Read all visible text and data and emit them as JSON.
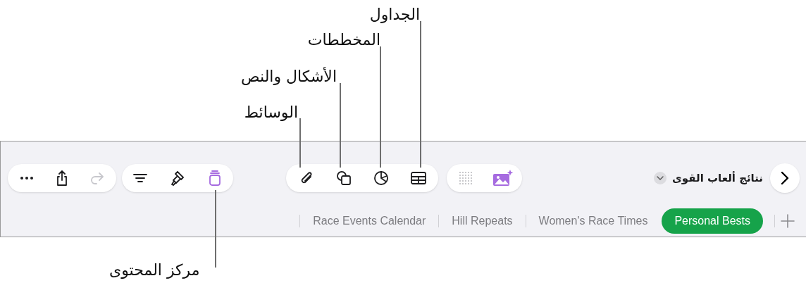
{
  "callouts": [
    {
      "text": "الجداول"
    },
    {
      "text": "المخططات"
    },
    {
      "text": "الأشكال والنص"
    },
    {
      "text": "الوسائط"
    },
    {
      "text": "مركز المحتوى"
    }
  ],
  "toolbar": {
    "redo": {
      "disabled": true
    },
    "content_center": {
      "selected": true
    }
  },
  "document_title": "نتائج ألعاب القوى",
  "tabs": [
    {
      "label": "Personal Bests",
      "selected": true
    },
    {
      "label": "Women's Race Times",
      "selected": false
    },
    {
      "label": "Hill Repeats",
      "selected": false
    },
    {
      "label": "Race Events Calendar",
      "selected": false
    }
  ]
}
